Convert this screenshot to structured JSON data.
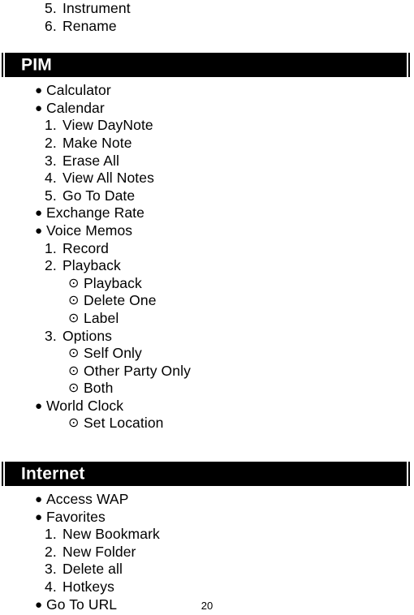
{
  "document": {
    "page_number": "20"
  },
  "top_continuation": {
    "items": [
      {
        "marker": "5.",
        "label": "Instrument",
        "level": "num"
      },
      {
        "marker": "6.",
        "label": "Rename",
        "level": "num"
      }
    ]
  },
  "sections": [
    {
      "title": "PIM",
      "items": [
        {
          "marker": "●",
          "label": "Calculator",
          "level": "bullet"
        },
        {
          "marker": "●",
          "label": "Calendar",
          "level": "bullet"
        },
        {
          "marker": "1.",
          "label": "View DayNote",
          "level": "num"
        },
        {
          "marker": "2.",
          "label": "Make Note",
          "level": "num"
        },
        {
          "marker": "3.",
          "label": "Erase All",
          "level": "num"
        },
        {
          "marker": "4.",
          "label": "View All Notes",
          "level": "num"
        },
        {
          "marker": "5.",
          "label": "Go To Date",
          "level": "num"
        },
        {
          "marker": "●",
          "label": "Exchange Rate",
          "level": "bullet"
        },
        {
          "marker": "●",
          "label": "Voice Memos",
          "level": "bullet"
        },
        {
          "marker": "1.",
          "label": "Record",
          "level": "num"
        },
        {
          "marker": "2.",
          "label": "Playback",
          "level": "num"
        },
        {
          "marker": "⊙",
          "label": "Playback",
          "level": "dot"
        },
        {
          "marker": "⊙",
          "label": "Delete One",
          "level": "dot"
        },
        {
          "marker": "⊙",
          "label": "Label",
          "level": "dot"
        },
        {
          "marker": "3.",
          "label": "Options",
          "level": "num"
        },
        {
          "marker": "⊙",
          "label": "Self Only",
          "level": "dot"
        },
        {
          "marker": "⊙",
          "label": "Other Party Only",
          "level": "dot"
        },
        {
          "marker": "⊙",
          "label": "Both",
          "level": "dot"
        },
        {
          "marker": "●",
          "label": "World Clock",
          "level": "bullet"
        },
        {
          "marker": "⊙",
          "label": "Set Location",
          "level": "dot"
        }
      ]
    },
    {
      "title": "Internet",
      "items": [
        {
          "marker": "●",
          "label": "Access WAP",
          "level": "bullet"
        },
        {
          "marker": "●",
          "label": "Favorites",
          "level": "bullet"
        },
        {
          "marker": "1.",
          "label": "New Bookmark",
          "level": "num"
        },
        {
          "marker": "2.",
          "label": "New Folder",
          "level": "num"
        },
        {
          "marker": "3.",
          "label": "Delete all",
          "level": "num"
        },
        {
          "marker": "4.",
          "label": "Hotkeys",
          "level": "num"
        },
        {
          "marker": "●",
          "label": "Go To URL",
          "level": "bullet"
        }
      ]
    }
  ]
}
